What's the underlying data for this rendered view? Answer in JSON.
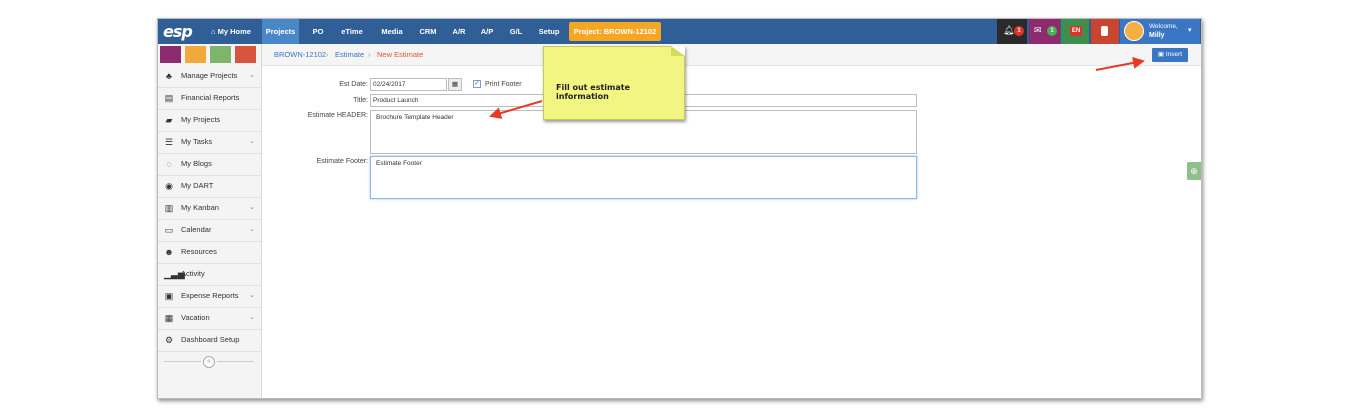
{
  "topbar": {
    "logo": "esp",
    "nav": [
      {
        "label": "⌂ My Home"
      },
      {
        "label": "Projects"
      },
      {
        "label": "PO"
      },
      {
        "label": "eTime"
      },
      {
        "label": "Media"
      },
      {
        "label": "CRM"
      },
      {
        "label": "A/R"
      },
      {
        "label": "A/P"
      },
      {
        "label": "G/L"
      },
      {
        "label": "Setup"
      }
    ],
    "project_button": "Project: BROWN-12102",
    "notifications_badge": "1",
    "messages_badge": "1",
    "language": "EN",
    "welcome": "Welcome,",
    "user_name": "Milly"
  },
  "colors": {
    "topbar": "#2f5f96",
    "active_nav": "#4a87c6",
    "project": "#f5a623",
    "swatches": [
      "#8e2a6e",
      "#f2a93b",
      "#7fb56a",
      "#d9543e"
    ],
    "accent_link": "#3b74b7",
    "accent_current": "#e0552e"
  },
  "sidebar": {
    "items": [
      {
        "label": "Manage Projects",
        "icon": "sitemap-icon",
        "chevron": true
      },
      {
        "label": "Financial Reports",
        "icon": "report-icon",
        "chevron": false
      },
      {
        "label": "My Projects",
        "icon": "folder-icon",
        "chevron": false
      },
      {
        "label": "My Tasks",
        "icon": "tasks-icon",
        "chevron": true
      },
      {
        "label": "My Blogs",
        "icon": "comments-icon",
        "chevron": false
      },
      {
        "label": "My DART",
        "icon": "dart-icon",
        "chevron": false
      },
      {
        "label": "My Kanban",
        "icon": "kanban-icon",
        "chevron": true
      },
      {
        "label": "Calendar",
        "icon": "calendar-icon",
        "chevron": true
      },
      {
        "label": "Resources",
        "icon": "users-icon",
        "chevron": false
      },
      {
        "label": "Activity",
        "icon": "signal-icon",
        "chevron": false
      },
      {
        "label": "Expense Reports",
        "icon": "money-icon",
        "chevron": true
      },
      {
        "label": "Vacation",
        "icon": "calendar-grid-icon",
        "chevron": true
      },
      {
        "label": "Dashboard Setup",
        "icon": "gears-icon",
        "chevron": false
      }
    ]
  },
  "breadcrumb": {
    "project": "BROWN-12102",
    "sep1": "›",
    "section": "Estimate",
    "sep2": "›",
    "current": "New Estimate"
  },
  "toolbar": {
    "insert_label": "Insert"
  },
  "form": {
    "est_date_label": "Est Date:",
    "est_date_value": "02/24/2017",
    "print_footer_label": "Print Footer",
    "print_footer_checked": true,
    "title_label": "Title:",
    "title_value": "Product Launch",
    "header_label": "Estimate HEADER:",
    "header_value": "Brochure Template Header",
    "footer_label": "Estimate Footer:",
    "footer_value": "Estimate Footer"
  },
  "callout": {
    "text": "Fill out estimate information"
  }
}
